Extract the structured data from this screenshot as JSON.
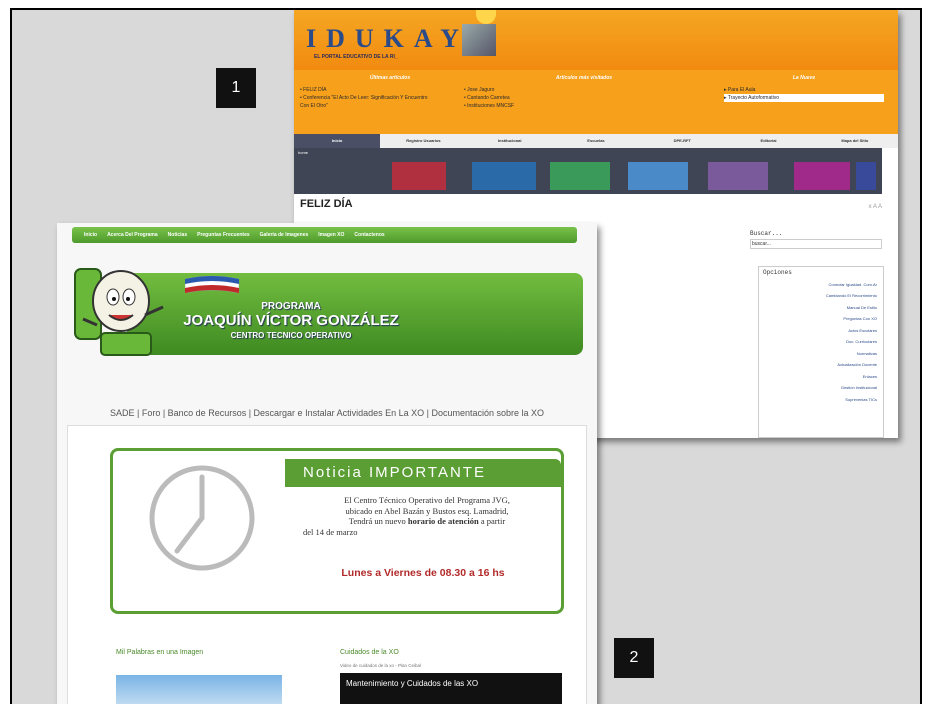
{
  "badges": {
    "one": "1",
    "two": "2"
  },
  "shot1": {
    "logo": "IDUKAY",
    "tagline": "EL PORTAL EDUCATIVO DE LA RI_",
    "col_headers": [
      "Últimas artículos",
      "Artículos más visitados",
      "La Nueve"
    ],
    "col1_items": [
      "• FELIZ DÍA",
      "• Conferencia \"El Acto De Leer: Significación Y Encuentro",
      "  Con El Otro\""
    ],
    "col2_items": [
      "• Jose Jaguro",
      "• Cantando Carretea",
      "• Instituciones MNCSF"
    ],
    "col3_items": [
      "▸ Para El Aula",
      "▸ Trayecto Autoformativo"
    ],
    "tabs": [
      "Inicio",
      "Registro Usuarios",
      "Institucional",
      "Escuelas",
      "DPE-RFT",
      "Editorial",
      "Mapa del Sitio"
    ],
    "tab_sub": "home",
    "page_title": "FELIZ DÍA",
    "search_label": "Buscar...",
    "search_placeholder": "buscar...",
    "options_title": "Opciones",
    "options": [
      "Conectar Igualdad .Com.Ar",
      "Cambiando El Recorrimiento",
      "Manual De Estilo",
      "Preguntas Con XO",
      "Actos Escolares",
      "Doc. Curriculares",
      "Normativas",
      "Actualización Docente",
      "Enlaces",
      "Gestión Institucional",
      "Suprevenias TICs"
    ],
    "text_size": "x A A"
  },
  "shot2": {
    "nav": [
      "Inicio",
      "Acerca Del Programa",
      "Noticias",
      "Preguntas Frecuentes",
      "Galería de Imagenes",
      "Imagen XO",
      "Contactenos"
    ],
    "banner_line1": "PROGRAMA",
    "banner_line2": "JOAQUÍN VÍCTOR GONZÁLEZ",
    "banner_line3": "CENTRO TECNICO OPERATIVO",
    "links": "SADE  |  Foro  |  Banco de Recursos  |  Descargar e Instalar Actividades En La XO  |  Documentación sobre la XO",
    "notice_title": "Noticia IMPORTANTE",
    "notice_body_1": "El Centro Técnico Operativo del Programa JVG,",
    "notice_body_2": "ubicado en Abel Bazán y Bustos esq. Lamadrid,",
    "notice_body_3_pre": "Tendrá un nuevo ",
    "notice_body_3_bold": "horario de atención",
    "notice_body_3_post": " a partir",
    "notice_body_4": "del 14 de marzo",
    "hours": "Lunes a Viernes de 08.30 a 16 hs",
    "section_left": "Mil Palabras en una Imagen",
    "section_right": "Cuidados de la XO",
    "section_right_sub": "Video de cuidados de la xo - Plan Ceibal",
    "video_title": "Mantenimiento y Cuidados de las XO"
  }
}
